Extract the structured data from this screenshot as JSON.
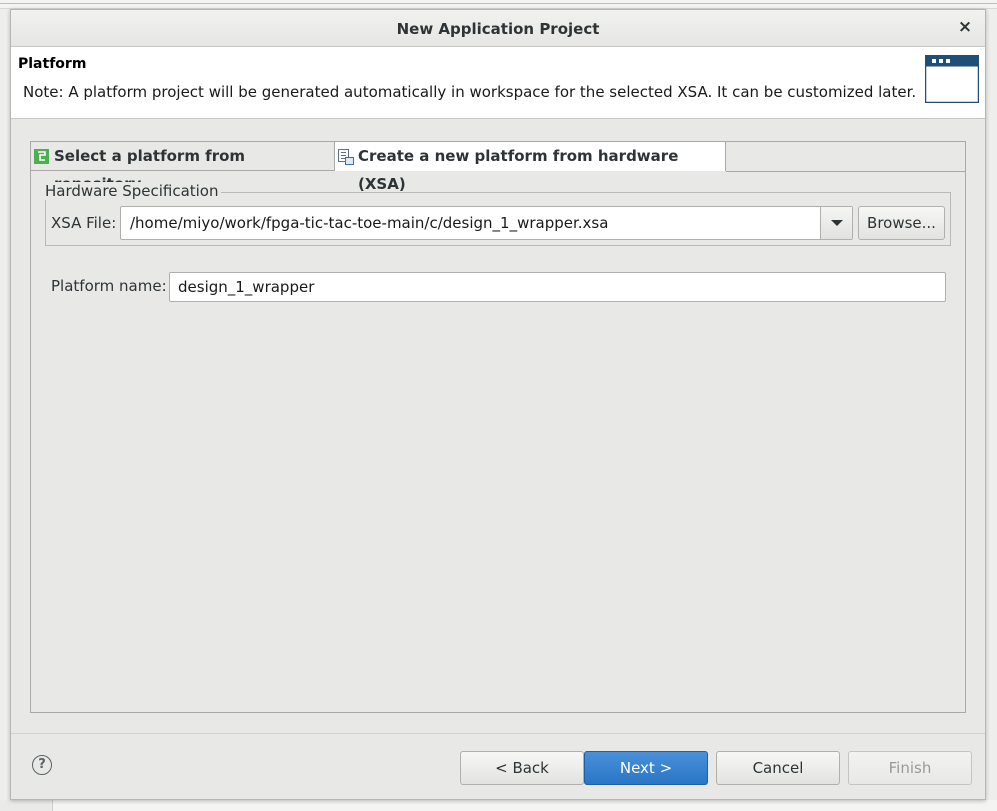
{
  "window": {
    "title": "New Application Project",
    "close_glyph": "×"
  },
  "header": {
    "title": "Platform",
    "note": "Note: A platform project will be generated automatically in workspace for the selected XSA. It can be customized later.",
    "icon": "window-icon"
  },
  "tabs": [
    {
      "label": "Select a platform from repository",
      "icon": "repository-icon",
      "selected": false
    },
    {
      "label": "Create a new platform from hardware (XSA)",
      "icon": "hardware-icon",
      "selected": true
    }
  ],
  "hardware": {
    "group_label": "Hardware Specification",
    "xsa_label": "XSA File:",
    "xsa_value": "/home/miyo/work/fpga-tic-tac-toe-main/c/design_1_wrapper.xsa",
    "browse_label": "Browse..."
  },
  "platform": {
    "name_label": "Platform name:",
    "name_value": "design_1_wrapper"
  },
  "footer": {
    "help_glyph": "?",
    "back_label": "< Back",
    "next_label": "Next >",
    "cancel_label": "Cancel",
    "finish_label": "Finish"
  },
  "colors": {
    "primary_button": "#2a76c6",
    "dialog_bg": "#e8e8e7",
    "tab_icon_green": "#4caf50"
  }
}
